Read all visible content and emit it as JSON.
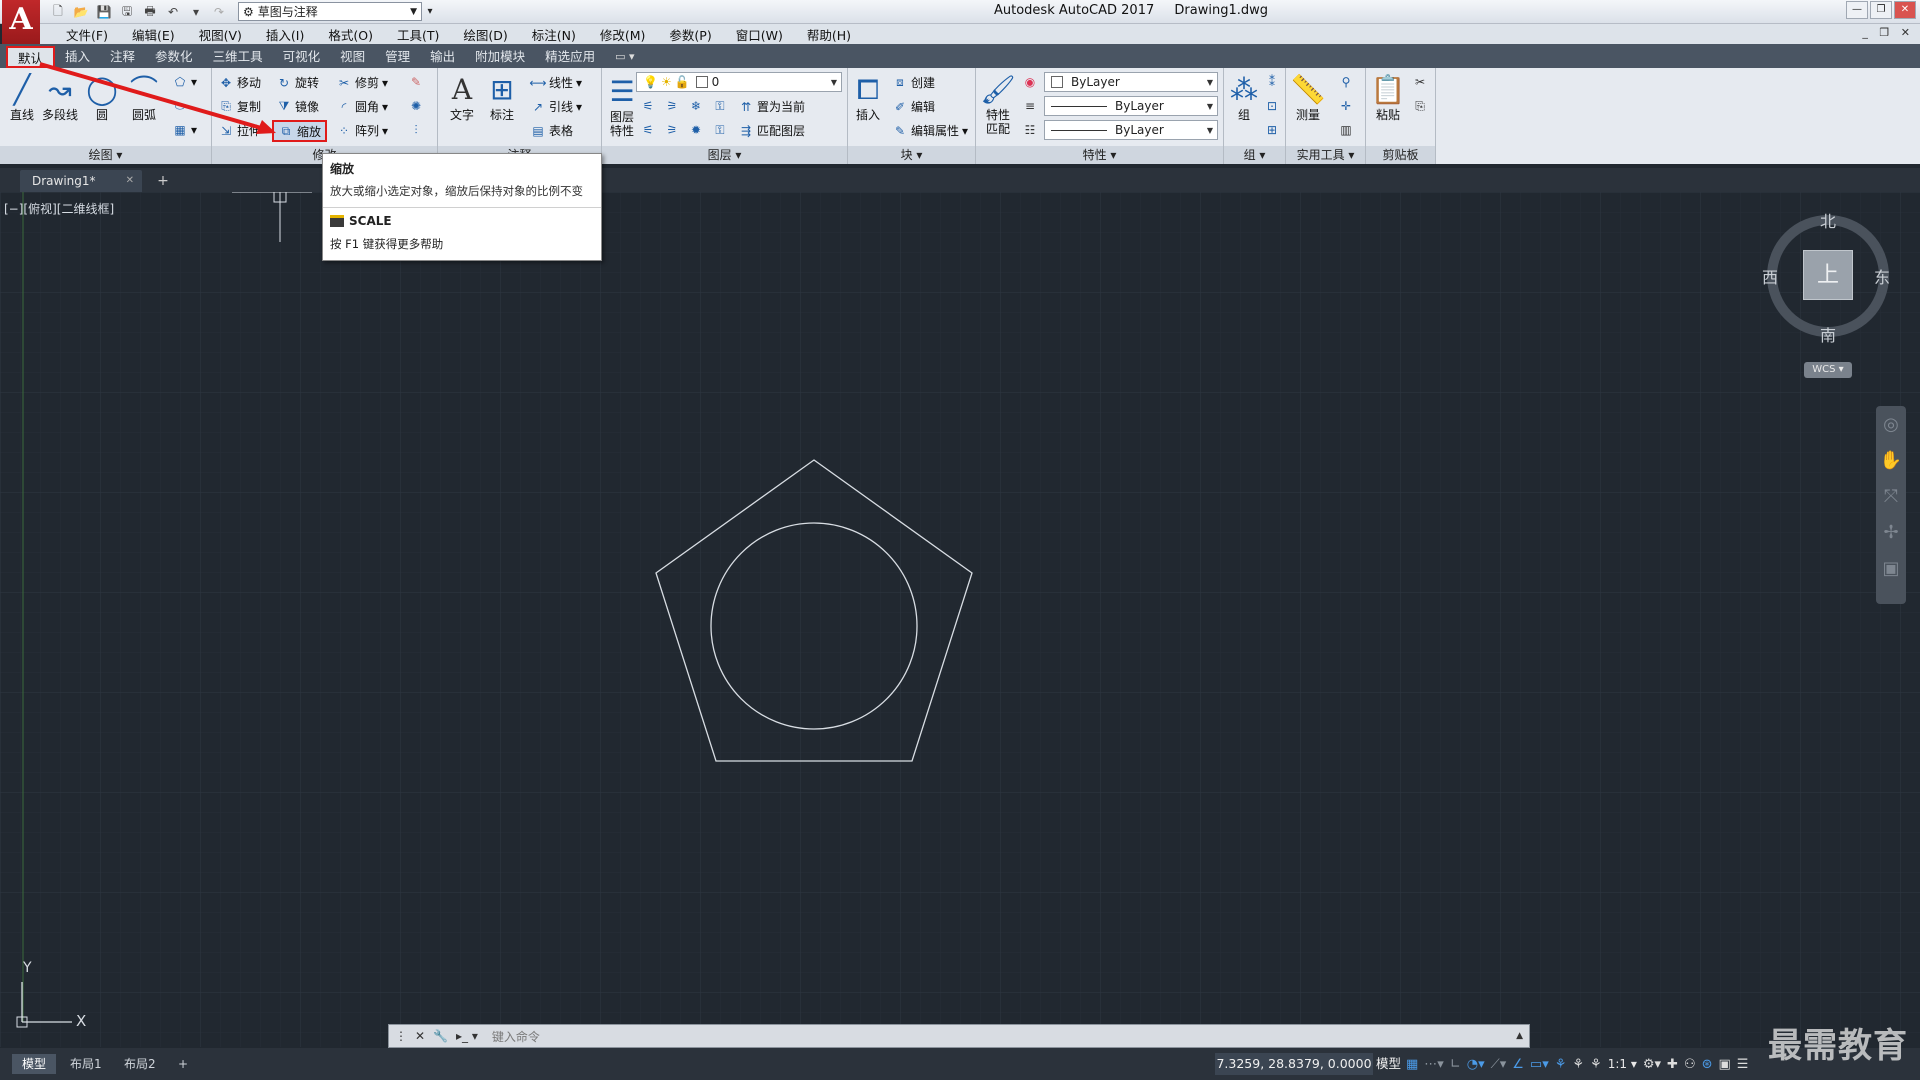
{
  "window": {
    "app_title": "Autodesk AutoCAD 2017",
    "file_title": "Drawing1.dwg",
    "logo": "A",
    "workspace": "草图与注释",
    "controls": [
      "—",
      "❐",
      "✕"
    ]
  },
  "menu": {
    "items": [
      "文件(F)",
      "编辑(E)",
      "视图(V)",
      "插入(I)",
      "格式(O)",
      "工具(T)",
      "绘图(D)",
      "标注(N)",
      "修改(M)",
      "参数(P)",
      "窗口(W)",
      "帮助(H)"
    ],
    "right": "_ ❐ ✕"
  },
  "ribbon_tabs": [
    "默认",
    "插入",
    "注释",
    "参数化",
    "三维工具",
    "可视化",
    "视图",
    "管理",
    "输出",
    "附加模块",
    "精选应用"
  ],
  "ribbon_tabs_extra": "▭ ▾",
  "panels": {
    "draw": {
      "title": "绘图 ▾",
      "line": "直线",
      "polyline": "多段线",
      "circle": "圆",
      "arc": "圆弧"
    },
    "modify": {
      "title": "修改",
      "move": "移动",
      "rotate": "旋转",
      "trim": "修剪",
      "copy": "复制",
      "mirror": "镜像",
      "fillet": "圆角",
      "stretch": "拉伸",
      "scale": "缩放",
      "array": "阵列"
    },
    "annotation": {
      "title": "注释",
      "text": "文字",
      "dimension": "标注",
      "linear": "线性",
      "leader": "引线",
      "table": "表格"
    },
    "layers": {
      "title": "图层 ▾",
      "layer_props": "图层\n特性",
      "current_layer": "0",
      "set_current": "置为当前",
      "match_layer": "匹配图层"
    },
    "block": {
      "title": "块 ▾",
      "insert": "插入",
      "create": "创建",
      "edit": "编辑",
      "edit_attr": "编辑属性"
    },
    "properties": {
      "title": "特性 ▾",
      "match": "特性\n匹配",
      "color": "ByLayer",
      "linetype": "ByLayer",
      "lineweight": "ByLayer"
    },
    "groups": {
      "title": "组 ▾",
      "group": "组"
    },
    "utilities": {
      "title": "实用工具 ▾",
      "measure": "测量"
    },
    "clipboard": {
      "title": "剪贴板",
      "paste": "粘贴"
    }
  },
  "tooltip": {
    "title": "缩放",
    "description": "放大或缩小选定对象，缩放后保持对象的比例不变",
    "command": "SCALE",
    "help": "按 F1 键获得更多帮助"
  },
  "file_tabs": {
    "active": "Drawing1*",
    "close": "✕",
    "add": "+"
  },
  "viewport": {
    "label": "[−][俯视][二维线框]",
    "viewcube": {
      "north": "北",
      "south": "南",
      "east": "东",
      "west": "西",
      "face": "上"
    },
    "wcs": "WCS ▾",
    "ucs_x": "X",
    "ucs_y": "Y"
  },
  "command_line": {
    "placeholder": "键入命令",
    "close": "✕",
    "settings": "🔧",
    "prompt_icon": "▸_ ▾",
    "expand": "▲"
  },
  "layout_tabs": [
    "模型",
    "布局1",
    "布局2",
    "+"
  ],
  "status": {
    "coords": "7.3259, 28.8379, 0.0000",
    "model": "模型",
    "scale": "1:1 ▾"
  },
  "watermark": "最需教育",
  "colors": {
    "canvas": "#212830",
    "highlight": "#e01b1b",
    "accent": "#1e5fa8"
  }
}
